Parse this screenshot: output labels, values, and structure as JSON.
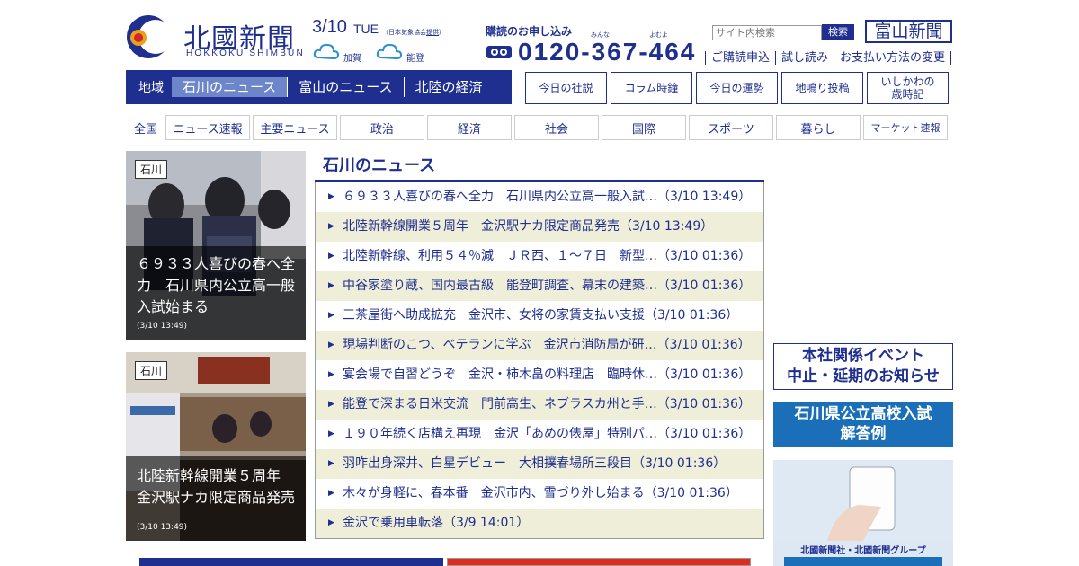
{
  "header": {
    "logo_ja": "北國新聞",
    "logo_en": "HOKKOKU SHIMBUN",
    "date": "3/10",
    "day_of_week": "TUE",
    "weather_credit_prefix": "（日本気象協会",
    "weather_credit_link": "提供",
    "weather_credit_suffix": "）",
    "weather": [
      {
        "region": "加賀",
        "icon": "cloud-icon"
      },
      {
        "region": "能登",
        "icon": "cloud-icon"
      }
    ],
    "subscribe_title": "購読のお申し込み",
    "ruby": [
      "みんな",
      "よむよ"
    ],
    "phone": "0120-367-464",
    "search_placeholder": "サイト内検索",
    "search_button": "検索",
    "toyama_button": "富山新聞",
    "top_links": [
      "ご購読申込",
      "試し読み",
      "お支払い方法の変更"
    ]
  },
  "region_nav": {
    "label": "地域",
    "tabs": [
      {
        "label": "石川のニュース",
        "active": true
      },
      {
        "label": "富山のニュース",
        "active": false
      },
      {
        "label": "北陸の経済",
        "active": false
      }
    ]
  },
  "feature_buttons": [
    "今日の社説",
    "コラム時鐘",
    "今日の運勢",
    "地鳴り投稿",
    "いしかわの\n歳時記"
  ],
  "category_nav": {
    "all_label": "全国",
    "categories": [
      "ニュース速報",
      "主要ニュース",
      "政治",
      "経済",
      "社会",
      "国際",
      "スポーツ",
      "暮らし",
      "マーケット速報"
    ]
  },
  "photo_stories": [
    {
      "tag": "石川",
      "caption": "６９３３人喜びの春へ全力　石川県内公立高一般入試始まる",
      "time": "(3/10 13:49)"
    },
    {
      "tag": "石川",
      "caption": "北陸新幹線開業５周年　金沢駅ナカ限定商品発売",
      "time": "(3/10 13:49)"
    }
  ],
  "news_section": {
    "title": "石川のニュース",
    "items": [
      "６９３３人喜びの春へ全力　石川県内公立高一般入試…（3/10 13:49）",
      "北陸新幹線開業５周年　金沢駅ナカ限定商品発売（3/10 13:49）",
      "北陸新幹線、利用５４％減　ＪＲ西、１～７日　新型…（3/10 01:36）",
      "中谷家塗り蔵、国内最古級　能登町調査、幕末の建築…（3/10 01:36）",
      "三茶屋街へ助成拡充　金沢市、女将の家賃支払い支援（3/10 01:36）",
      "現場判断のこつ、ベテランに学ぶ　金沢市消防局が研…（3/10 01:36）",
      "宴会場で自習どうぞ　金沢・柿木畠の料理店　臨時休…（3/10 01:36）",
      "能登で深まる日米交流　門前高生、ネブラスカ州と手…（3/10 01:36）",
      "１９０年続く店構え再現　金沢「あめの俵屋」特別パ…（3/10 01:36）",
      "羽咋出身深井、白星デビュー　大相撲春場所三段目（3/10 01:36）",
      "木々が身軽に、春本番　金沢市内、雪づり外し始まる（3/10 01:36）",
      "金沢で乗用車転落（3/9 14:01）"
    ]
  },
  "ads": {
    "event_notice": [
      "本社関係イベント",
      "中止・延期のお知らせ"
    ],
    "exam_answers": [
      "石川県公立高校入試",
      "解答例"
    ],
    "group_banner": "北國新聞社・北國新聞グループ"
  },
  "colors": {
    "brand_navy": "#1f2f8f",
    "active_tab": "#6c86c9",
    "stripe": "#efeed8",
    "exam_blue": "#1a6fb8"
  }
}
